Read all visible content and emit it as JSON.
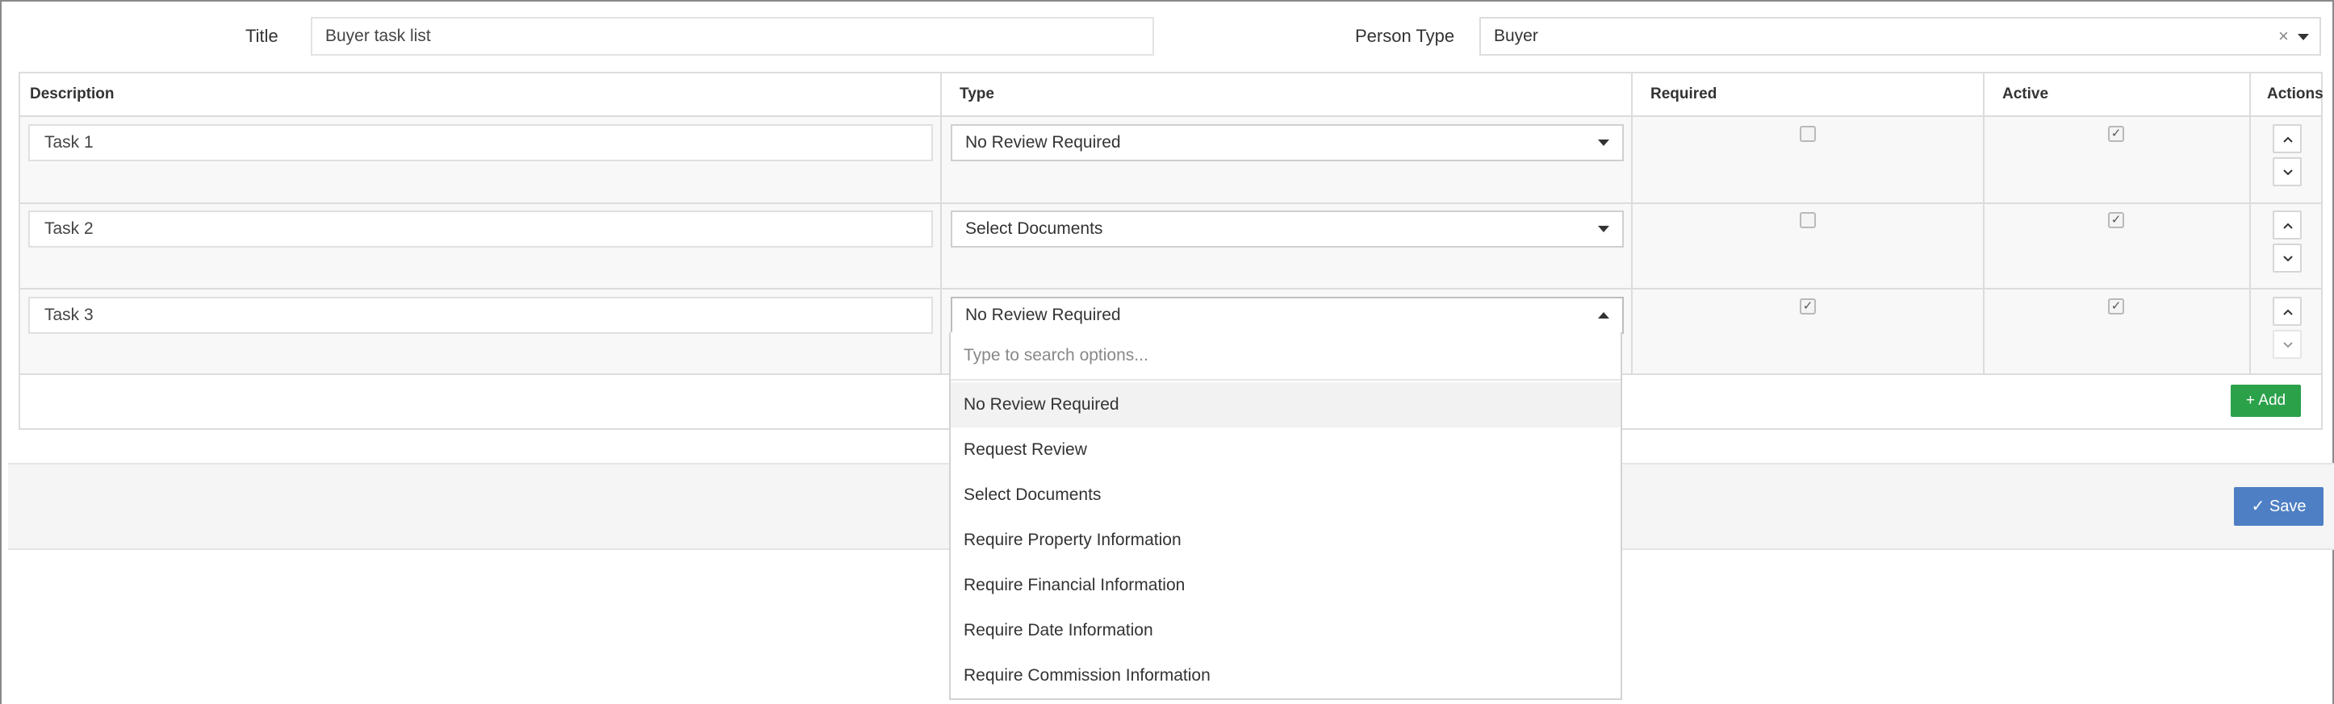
{
  "form": {
    "title_label": "Title",
    "title_value": "Buyer task list",
    "person_type_label": "Person Type",
    "person_type_value": "Buyer",
    "clear_symbol": "×"
  },
  "table": {
    "headers": [
      "Description",
      "Type",
      "Required",
      "Active",
      "Actions"
    ],
    "rows": [
      {
        "description": "Task 1",
        "type": "No Review Required",
        "required": false,
        "active": true
      },
      {
        "description": "Task 2",
        "type": "Select Documents",
        "required": false,
        "active": true
      },
      {
        "description": "Task 3",
        "type": "No Review Required",
        "required": true,
        "active": true
      }
    ],
    "check_glyph": "✓"
  },
  "buttons": {
    "add_label": "Add",
    "add_icon": "+",
    "save_label": "Save",
    "save_icon": "✓"
  },
  "dropdown": {
    "search_placeholder": "Type to search options...",
    "options": [
      "No Review Required",
      "Request Review",
      "Select Documents",
      "Require Property Information",
      "Require Financial Information",
      "Require Date Information",
      "Require Commission Information"
    ],
    "highlighted": "No Review Required"
  },
  "colors": {
    "add_button": "#2ba14a",
    "save_button": "#4e7fc4",
    "border": "#dcdcdc",
    "row_background": "#f7f8f7"
  }
}
